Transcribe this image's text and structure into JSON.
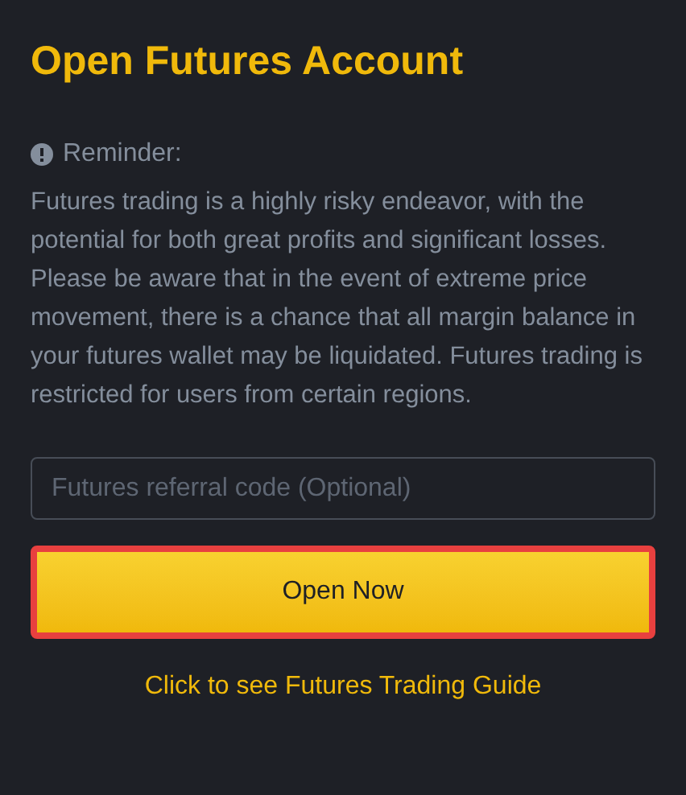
{
  "title": "Open Futures Account",
  "reminder": {
    "label": "Reminder:",
    "text": "Futures trading is a highly risky endeavor, with the potential for both great profits and significant losses. Please be aware that in the event of extreme price movement, there is a chance that all margin balance in your futures wallet may be liquidated. Futures trading is restricted for users from certain regions."
  },
  "referral_field": {
    "placeholder": "Futures referral code (Optional)"
  },
  "open_button": {
    "label": "Open Now",
    "highlighted": true
  },
  "guide_link": "Click to see Futures Trading Guide"
}
